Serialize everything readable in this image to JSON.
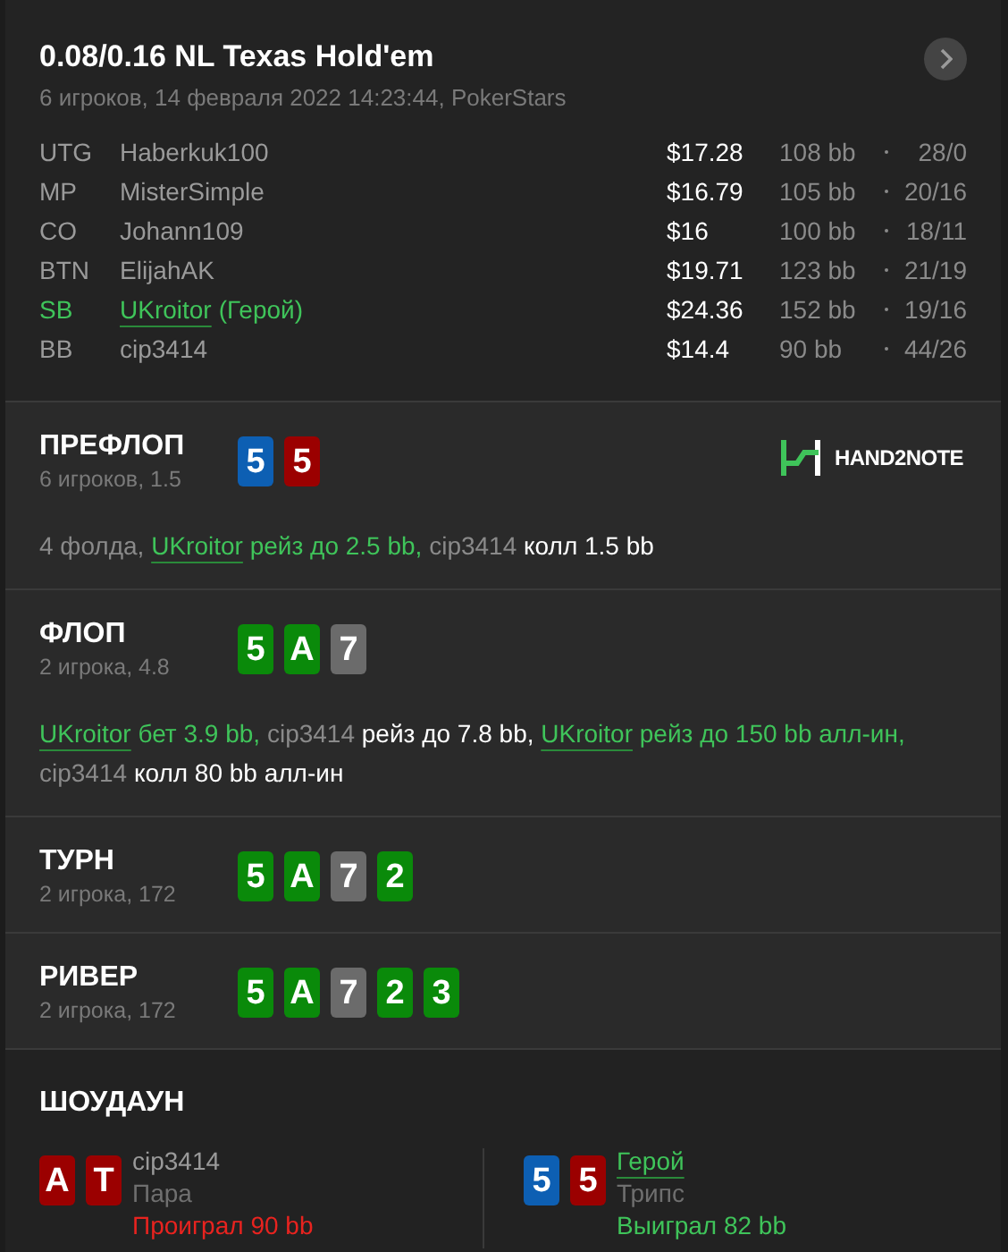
{
  "header": {
    "title": "0.08/0.16 NL Texas Hold'em",
    "subtitle": "6 игроков, 14 февраля 2022 14:23:44, PokerStars"
  },
  "players": [
    {
      "position": "UTG",
      "name": "Haberkuk100",
      "hero": false,
      "stack": "$17.28",
      "bb": "108 bb",
      "stats": "28/0"
    },
    {
      "position": "MP",
      "name": "MisterSimple",
      "hero": false,
      "stack": "$16.79",
      "bb": "105 bb",
      "stats": "20/16"
    },
    {
      "position": "CO",
      "name": "Johann109",
      "hero": false,
      "stack": "$16",
      "bb": "100 bb",
      "stats": "18/11"
    },
    {
      "position": "BTN",
      "name": "ElijahAK",
      "hero": false,
      "stack": "$19.71",
      "bb": "123 bb",
      "stats": "21/19"
    },
    {
      "position": "SB",
      "name": "UKroitor",
      "hero": true,
      "hero_tag": "(Герой)",
      "stack": "$24.36",
      "bb": "152 bb",
      "stats": "19/16"
    },
    {
      "position": "BB",
      "name": "cip3414",
      "hero": false,
      "stack": "$14.4",
      "bb": "90 bb",
      "stats": "44/26"
    }
  ],
  "streets": [
    {
      "name": "ПРЕФЛОП",
      "info": "6 игроков, 1.5",
      "logo": "HAND2NOTE",
      "cards": [
        {
          "rank": "5",
          "color": "#0d5fb3"
        },
        {
          "rank": "5",
          "color": "#9b0000"
        }
      ],
      "actions": [
        {
          "kind": "note",
          "text": "4 фолда,"
        },
        {
          "kind": "hero",
          "text": "UKroitor"
        },
        {
          "kind": "hero_action",
          "text": "рейз до 2.5 bb,"
        },
        {
          "kind": "player",
          "text": "cip3414"
        },
        {
          "kind": "action",
          "text": "колл 1.5 bb"
        }
      ]
    },
    {
      "name": "ФЛОП",
      "info": "2 игрока, 4.8",
      "cards": [
        {
          "rank": "5",
          "color": "#0a8a0a"
        },
        {
          "rank": "A",
          "color": "#0a8a0a"
        },
        {
          "rank": "7",
          "color": "#6b6b6b"
        }
      ],
      "actions": [
        {
          "kind": "hero",
          "text": "UKroitor"
        },
        {
          "kind": "hero_action",
          "text": "бет 3.9 bb,"
        },
        {
          "kind": "player",
          "text": "cip3414"
        },
        {
          "kind": "action",
          "text": "рейз до 7.8 bb,"
        },
        {
          "kind": "hero",
          "text": "UKroitor"
        },
        {
          "kind": "hero_action",
          "text": "рейз до 150 bb алл-ин,"
        },
        {
          "kind": "player",
          "text": "cip3414"
        },
        {
          "kind": "action",
          "text": "колл 80 bb алл-ин"
        }
      ]
    },
    {
      "name": "ТУРН",
      "info": "2 игрока, 172",
      "cards": [
        {
          "rank": "5",
          "color": "#0a8a0a"
        },
        {
          "rank": "A",
          "color": "#0a8a0a"
        },
        {
          "rank": "7",
          "color": "#6b6b6b"
        },
        {
          "rank": "2",
          "color": "#0a8a0a"
        }
      ]
    },
    {
      "name": "РИВЕР",
      "info": "2 игрока, 172",
      "cards": [
        {
          "rank": "5",
          "color": "#0a8a0a"
        },
        {
          "rank": "A",
          "color": "#0a8a0a"
        },
        {
          "rank": "7",
          "color": "#6b6b6b"
        },
        {
          "rank": "2",
          "color": "#0a8a0a"
        },
        {
          "rank": "3",
          "color": "#0a8a0a"
        }
      ]
    }
  ],
  "showdown": {
    "title": "ШОУДАУН",
    "hands": [
      {
        "cards": [
          {
            "rank": "A",
            "color": "#9b0000"
          },
          {
            "rank": "T",
            "color": "#9b0000"
          }
        ],
        "name": "cip3414",
        "hero": false,
        "combo": "Пара",
        "result": "Проиграл 90 bb",
        "kind": "lose"
      },
      {
        "cards": [
          {
            "rank": "5",
            "color": "#0d5fb3"
          },
          {
            "rank": "5",
            "color": "#9b0000"
          }
        ],
        "name": "Герой",
        "hero": true,
        "combo": "Трипс",
        "result": "Выиграл 82 bb",
        "kind": "win"
      }
    ]
  }
}
